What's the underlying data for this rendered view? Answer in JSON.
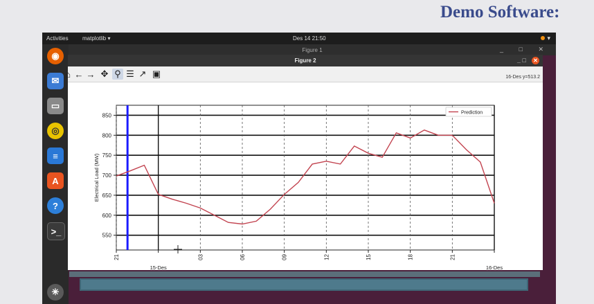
{
  "slide": {
    "title": "Demo Software:"
  },
  "topbar": {
    "activities": "Activities",
    "app_menu": "matplotlib ▾",
    "clock": "Des 14  21:50",
    "tray": "▾"
  },
  "window1": {
    "title": "Figure 1",
    "controls": "_ □ ✕"
  },
  "window2": {
    "title": "Figure 2",
    "controls": "_   □",
    "close": "✕"
  },
  "toolbar": {
    "buttons": [
      "home-icon",
      "back-icon",
      "forward-icon",
      "pan-icon",
      "zoom-icon",
      "configure-subplots-icon",
      "edit-axis-icon",
      "save-icon"
    ],
    "coord_readout": "16-Des y=513.2"
  },
  "dock": {
    "icons": [
      "firefox-icon",
      "mail-icon",
      "files-icon",
      "rhythmbox-icon",
      "writer-icon",
      "software-center-icon",
      "help-icon",
      "terminal-icon",
      "show-apps-icon"
    ]
  },
  "chart_data": {
    "type": "line",
    "ylabel": "Electrical Load (MW)",
    "xlabel": "",
    "ylim": [
      513,
      875
    ],
    "yticks": [
      550,
      600,
      650,
      700,
      750,
      800,
      850
    ],
    "xticks": [
      {
        "h": 21,
        "label": "21"
      },
      {
        "h": 24,
        "label": "15-Des"
      },
      {
        "h": 27,
        "label": "03"
      },
      {
        "h": 30,
        "label": "06"
      },
      {
        "h": 33,
        "label": "09"
      },
      {
        "h": 36,
        "label": "12"
      },
      {
        "h": 39,
        "label": "15"
      },
      {
        "h": 42,
        "label": "18"
      },
      {
        "h": 45,
        "label": "21"
      },
      {
        "h": 48,
        "label": "16-Des"
      }
    ],
    "xlim": [
      21,
      48
    ],
    "legend": {
      "entry": "Prediction",
      "position": "top-right"
    },
    "series": [
      {
        "name": "Prediction",
        "color": "#c2434f",
        "x": [
          21,
          22,
          23,
          24,
          25,
          26,
          27,
          28,
          29,
          30,
          31,
          32,
          33,
          34,
          35,
          36,
          37,
          38,
          39,
          40,
          41,
          42,
          43,
          44,
          45,
          46,
          47,
          48
        ],
        "y": [
          698,
          711,
          725,
          652,
          640,
          630,
          618,
          600,
          582,
          578,
          585,
          615,
          652,
          682,
          728,
          735,
          728,
          773,
          755,
          745,
          806,
          793,
          813,
          800,
          800,
          764,
          733,
          630
        ]
      }
    ],
    "vlines": [
      {
        "x": 21.8,
        "color": "#1a1aff",
        "width": 3
      },
      {
        "x": 24,
        "color": "#111111",
        "width": 1.4
      },
      {
        "x": 48,
        "color": "#111111",
        "width": 1.4
      }
    ],
    "grid": true
  }
}
